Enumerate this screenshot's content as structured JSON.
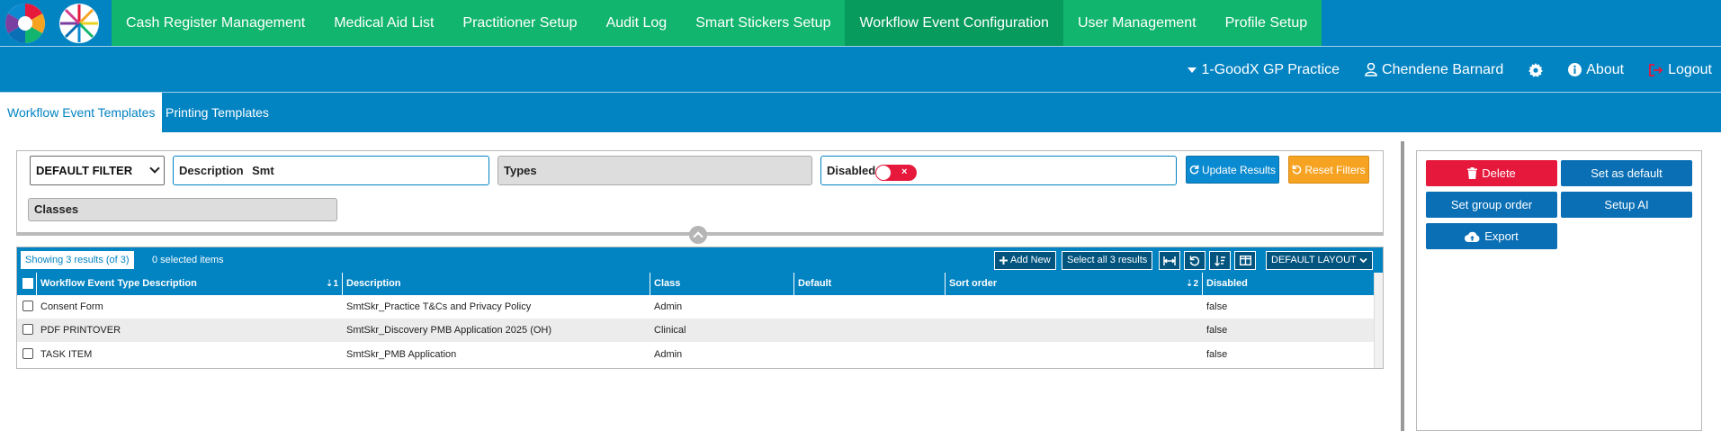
{
  "nav": {
    "items": [
      {
        "label": "Cash Register Management"
      },
      {
        "label": "Medical Aid List"
      },
      {
        "label": "Practitioner Setup"
      },
      {
        "label": "Audit Log"
      },
      {
        "label": "Smart Stickers Setup"
      },
      {
        "label": "Workflow Event Configuration",
        "active": true
      },
      {
        "label": "User Management"
      },
      {
        "label": "Profile Setup"
      }
    ]
  },
  "userbar": {
    "practice": "1-GoodX GP Practice",
    "user": "Chendene Barnard",
    "about": "About",
    "logout": "Logout"
  },
  "tabs": {
    "active": "Workflow Event Templates",
    "other": "Printing Templates"
  },
  "filters": {
    "filter_select": "DEFAULT FILTER",
    "description_label": "Description",
    "description_value": "Smt",
    "types_label": "Types",
    "disabled_label": "Disabled",
    "classes_label": "Classes",
    "update_label": "Update Results",
    "reset_label": "Reset Filters"
  },
  "grid": {
    "showing": "Showing 3 results (of 3)",
    "selected": "0 selected items",
    "add_new": "Add New",
    "select_all": "Select all 3 results",
    "layout": "DEFAULT LAYOUT",
    "columns": [
      {
        "label": "Workflow Event Type Description",
        "sort": "1"
      },
      {
        "label": "Description"
      },
      {
        "label": "Class"
      },
      {
        "label": "Default"
      },
      {
        "label": "Sort order",
        "sort": "2"
      },
      {
        "label": "Disabled"
      }
    ],
    "rows": [
      [
        "Consent Form",
        "SmtSkr_Practice T&Cs and Privacy Policy",
        "Admin",
        "",
        "",
        "false"
      ],
      [
        "PDF PRINTOVER",
        "SmtSkr_Discovery PMB Application 2025 (OH)",
        "Clinical",
        "",
        "",
        "false"
      ],
      [
        "TASK ITEM",
        "SmtSkr_PMB Application",
        "Admin",
        "",
        "",
        "false"
      ]
    ]
  },
  "actions": {
    "delete": "Delete",
    "set_default": "Set as default",
    "set_group_order": "Set group order",
    "setup_ai": "Setup AI",
    "export": "Export"
  },
  "colors": {
    "primary": "#0283c2",
    "nav_green": "#12b56e",
    "nav_green_active": "#079b5d",
    "danger": "#e6183c",
    "warning": "#f7a322"
  }
}
